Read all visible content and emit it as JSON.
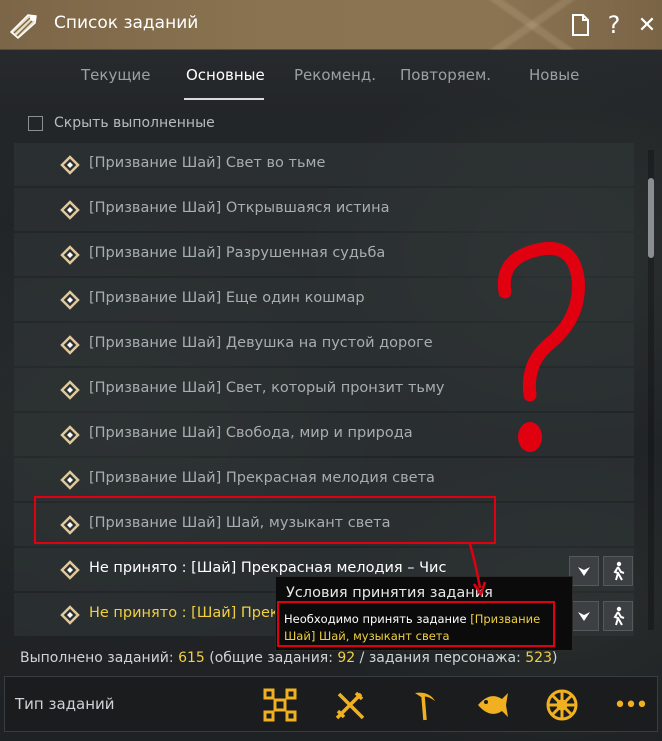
{
  "window": {
    "title": "Список заданий",
    "icons": [
      "scroll-icon",
      "document-icon",
      "help-icon",
      "close-icon"
    ],
    "help_glyph": "?",
    "close_glyph": "✕"
  },
  "tabs": [
    {
      "label": "Текущие",
      "active": false
    },
    {
      "label": "Основные",
      "active": true
    },
    {
      "label": "Рекоменд.",
      "active": false
    },
    {
      "label": "Повторяем.",
      "active": false
    },
    {
      "label": "Новые",
      "active": false
    }
  ],
  "filter": {
    "hide_completed_label": "Скрыть выполненные",
    "checked": false
  },
  "quests": [
    {
      "text": "[Призвание Шай] Свет во тьме",
      "status": "completed"
    },
    {
      "text": "[Призвание Шай] Открывшаяся истина",
      "status": "completed"
    },
    {
      "text": "[Призвание Шай] Разрушенная судьба",
      "status": "completed"
    },
    {
      "text": "[Призвание Шай] Еще один кошмар",
      "status": "completed"
    },
    {
      "text": "[Призвание Шай] Девушка на пустой дороге",
      "status": "completed"
    },
    {
      "text": "[Призвание Шай] Свет, который пронзит тьму",
      "status": "completed"
    },
    {
      "text": "[Призвание Шай] Свобода, мир и природа",
      "status": "completed"
    },
    {
      "text": "[Призвание Шай] Прекрасная мелодия света",
      "status": "completed"
    },
    {
      "text": "[Призвание Шай] Шай, музыкант света",
      "status": "completed"
    },
    {
      "text": "Не принято : [Шай] Прекрасная мелодия – Чис",
      "status": "not-accepted"
    },
    {
      "text": "Не принято : [Шай] Прекрасная мелодия – Зап",
      "status": "not-accepted-highlight"
    }
  ],
  "tooltip": {
    "title": "Условия принятия задания",
    "body_prefix": "Необходимо принять задание ",
    "body_highlight": "[Призвание Шай] Шай, музыкант света"
  },
  "stats": {
    "label": "Выполнено заданий: ",
    "total_completed": "615",
    "general_label": " (общие задания: ",
    "general": "92",
    "character_label": " / задания персонажа: ",
    "character": "523",
    "suffix": ")"
  },
  "footer": {
    "label": "Тип заданий",
    "icons": [
      "frame-icon",
      "crossed-swords-icon",
      "pickaxe-icon",
      "fish-icon",
      "wheel-icon",
      "more-icon"
    ],
    "more_glyph": "•••"
  },
  "colors": {
    "accent_yellow": "#f0d040",
    "titlebar": "#8a7350",
    "annotation_red": "#e00010"
  }
}
